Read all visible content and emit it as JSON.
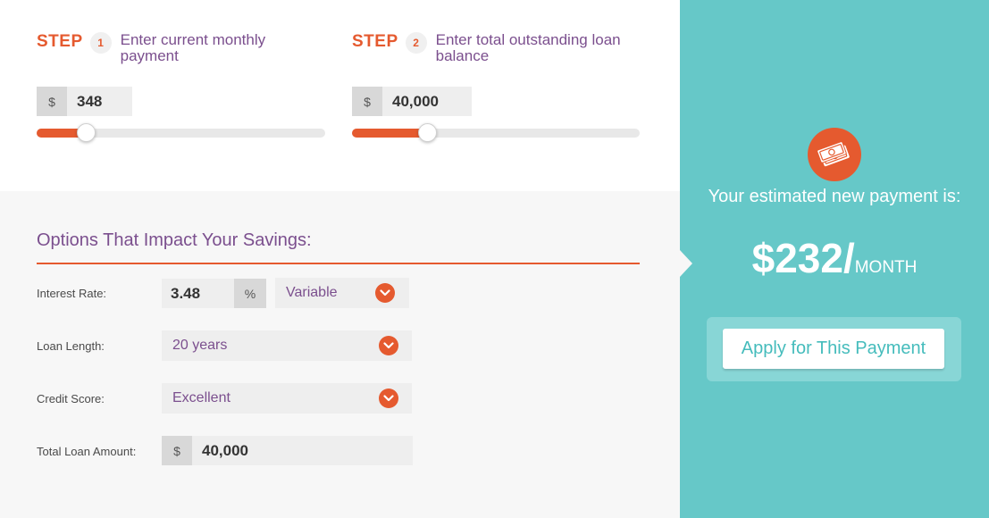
{
  "step1": {
    "word": "STEP",
    "number": "1",
    "text": "Enter current monthly payment",
    "currency": "$",
    "value": "348",
    "slider_fraction": 0.17
  },
  "step2": {
    "word": "STEP",
    "number": "2",
    "text": "Enter total outstanding loan balance",
    "currency": "$",
    "value": "40,000",
    "slider_fraction": 0.26
  },
  "options": {
    "title": "Options That Impact Your Savings:",
    "interest_rate": {
      "label": "Interest Rate:",
      "value": "3.48",
      "unit": "%",
      "type": "Variable"
    },
    "loan_length": {
      "label": "Loan Length:",
      "value": "20 years"
    },
    "credit_score": {
      "label": "Credit Score:",
      "value": "Excellent"
    },
    "total_loan": {
      "label": "Total Loan Amount:",
      "currency": "$",
      "value": "40,000"
    }
  },
  "result": {
    "icon": "money-icon",
    "estimate_text": "Your estimated new payment is:",
    "amount": "$232/",
    "period": "MONTH",
    "apply_label": "Apply for This Payment"
  },
  "colors": {
    "accent": "#e55a2f",
    "purple": "#7b4f8e",
    "teal": "#66c8c8"
  }
}
